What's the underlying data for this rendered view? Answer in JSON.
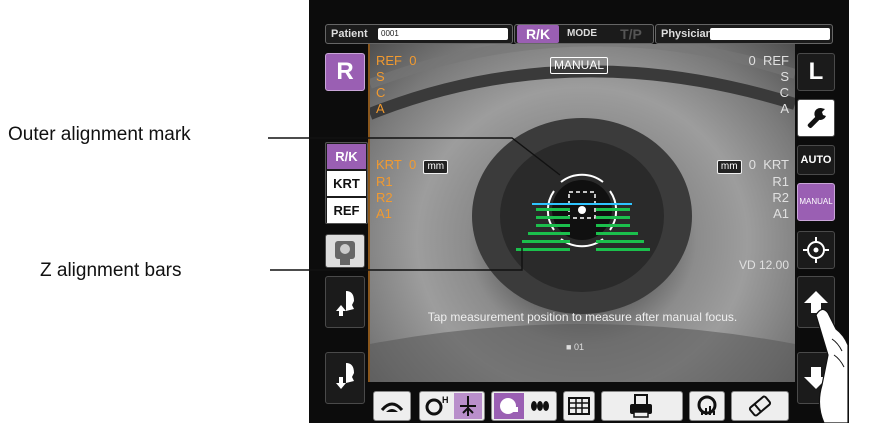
{
  "callouts": {
    "outer_alignment": "Outer alignment mark",
    "z_alignment": "Z alignment bars"
  },
  "topbar": {
    "patient_label": "Patient",
    "patient_value": "0001",
    "mode_rk": "R/K",
    "mode_label": "MODE",
    "mode_tp": "T/P",
    "physician_label": "Physician",
    "physician_value": ""
  },
  "eye_selector": {
    "right": "R",
    "left": "L"
  },
  "overlay": {
    "manual_badge": "MANUAL",
    "left_ref": {
      "header": "REF",
      "value": "0",
      "s": "S",
      "c": "C",
      "a": "A"
    },
    "right_ref": {
      "header": "REF",
      "value": "0",
      "s": "S",
      "c": "C",
      "a": "A"
    },
    "left_krt": {
      "header": "KRT",
      "value": "0",
      "unit": "mm",
      "r1": "R1",
      "r2": "R2",
      "a1": "A1"
    },
    "right_krt": {
      "header": "KRT",
      "value": "0",
      "unit": "mm",
      "r1": "R1",
      "r2": "R2",
      "a1": "A1"
    },
    "vd": "VD 12.00",
    "instruction": "Tap measurement position to measure after manual focus.",
    "counter": "01"
  },
  "left_panel": {
    "rk": "R/K",
    "krt": "KRT",
    "ref": "REF"
  },
  "right_panel": {
    "auto": "AUTO",
    "manual": "MANUAL"
  },
  "icons": {
    "wrench": "wrench-icon",
    "target": "crosshair-icon",
    "up": "arrow-up-icon",
    "down": "arrow-down-icon",
    "chin_up": "chinrest-up-icon",
    "chin_down": "chinrest-down-icon",
    "eye_patient": "patient-eye-icon",
    "print": "print-icon",
    "eraser": "eraser-icon",
    "table": "table-icon"
  },
  "colors": {
    "accent_purple": "#9a5fb3",
    "ref_orange": "#f29a2f",
    "z_bar_green": "#1bbf4c",
    "alignment_cyan": "#2ec4ff"
  }
}
